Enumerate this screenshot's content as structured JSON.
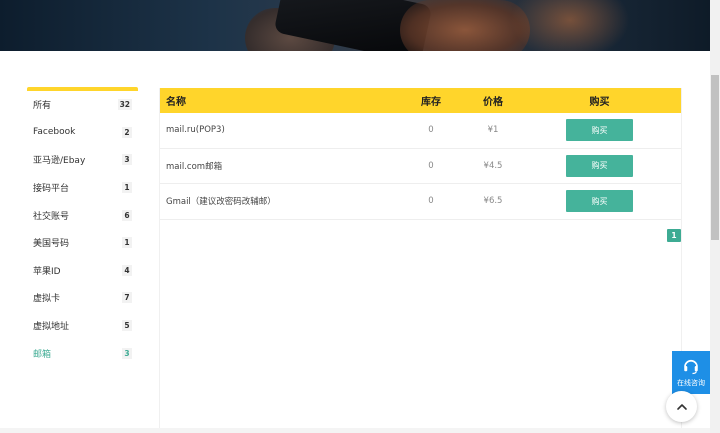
{
  "sidebar": {
    "categories": [
      {
        "label": "所有",
        "count": "32"
      },
      {
        "label": "Facebook",
        "count": "2"
      },
      {
        "label": "亚马逊/Ebay",
        "count": "3"
      },
      {
        "label": "接码平台",
        "count": "1"
      },
      {
        "label": "社交账号",
        "count": "6"
      },
      {
        "label": "美国号码",
        "count": "1"
      },
      {
        "label": "苹果ID",
        "count": "4"
      },
      {
        "label": "虚拟卡",
        "count": "7"
      },
      {
        "label": "虚拟地址",
        "count": "5"
      },
      {
        "label": "邮箱",
        "count": "3"
      }
    ],
    "active_index": 9
  },
  "table": {
    "headers": {
      "name": "名称",
      "stock": "库存",
      "price": "价格",
      "buy": "购买"
    },
    "rows": [
      {
        "name": "mail.ru(POP3)",
        "stock": "0",
        "price": "¥1",
        "buy": "购买"
      },
      {
        "name": "mail.com邮箱",
        "stock": "0",
        "price": "¥4.5",
        "buy": "购买"
      },
      {
        "name": "Gmail（建议改密码改辅邮）",
        "stock": "0",
        "price": "¥6.5",
        "buy": "购买"
      }
    ]
  },
  "pagination": {
    "current": "1"
  },
  "chat_widget": {
    "label": "在线咨询"
  },
  "colors": {
    "accent_yellow": "#ffd52b",
    "accent_green": "#45b39b",
    "chat_blue": "#1e8fe6"
  },
  "icons": {
    "chat": "headset-icon",
    "back_to_top": "chevron-up-icon"
  }
}
